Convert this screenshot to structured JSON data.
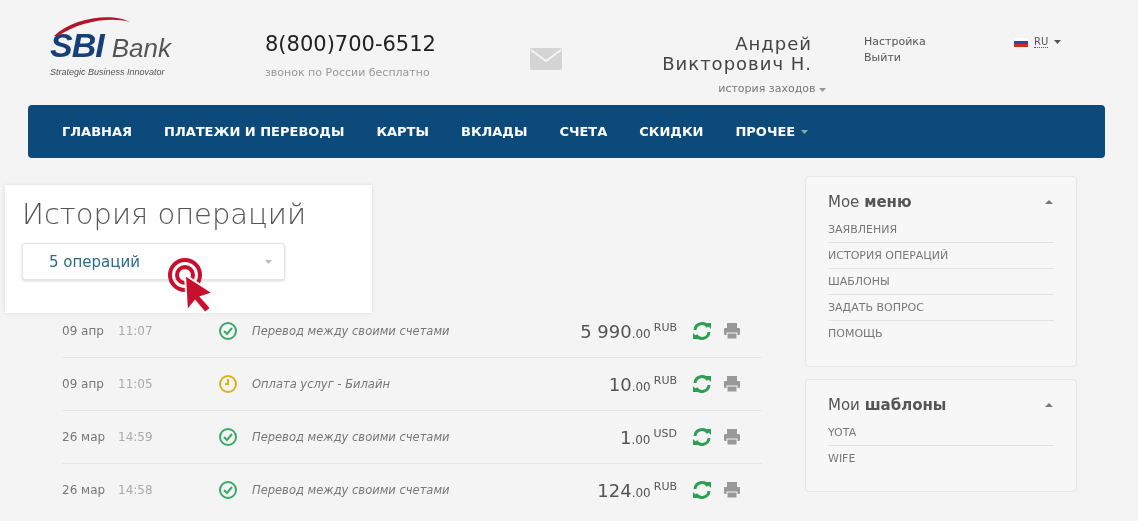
{
  "header": {
    "logo": {
      "name": "SBI",
      "suffix": "Bank",
      "tagline": "Strategic Business Innovator"
    },
    "phone": {
      "number": "8(800)700-6512",
      "note": "звонок по России бесплатно"
    },
    "user": {
      "name_line1": "Андрей",
      "name_line2": "Викторович Н.",
      "history_link": "история заходов"
    },
    "links": [
      "Настройка",
      "Выйти"
    ],
    "language": "RU"
  },
  "nav": [
    {
      "label": "ГЛАВНАЯ",
      "has_dropdown": false
    },
    {
      "label": "ПЛАТЕЖИ И ПЕРЕВОДЫ",
      "has_dropdown": false
    },
    {
      "label": "КАРТЫ",
      "has_dropdown": false
    },
    {
      "label": "ВКЛАДЫ",
      "has_dropdown": false
    },
    {
      "label": "СЧЕТА",
      "has_dropdown": false
    },
    {
      "label": "СКИДКИ",
      "has_dropdown": false
    },
    {
      "label": "ПРОЧЕЕ",
      "has_dropdown": true
    }
  ],
  "page": {
    "title": "История операций",
    "filter": {
      "value": "5 операций"
    }
  },
  "operations": [
    {
      "date": "09 апр",
      "time": "11:07",
      "kind": "done",
      "description": "Перевод между своими счетами",
      "amount": "5 990",
      "cents": ".00",
      "currency": "RUB"
    },
    {
      "date": "09 апр",
      "time": "11:05",
      "kind": "pending",
      "description": "Оплата услуг - Билайн",
      "amount": "10",
      "cents": ".00",
      "currency": "RUB"
    },
    {
      "date": "26 мар",
      "time": "14:59",
      "kind": "done",
      "description": "Перевод между своими счетами",
      "amount": "1",
      "cents": ".00",
      "currency": "USD"
    },
    {
      "date": "26 мар",
      "time": "14:58",
      "kind": "done",
      "description": "Перевод между своими счетами",
      "amount": "124",
      "cents": ".00",
      "currency": "RUB"
    }
  ],
  "sidebar": [
    {
      "title": "Мое **меню**",
      "expanded": true,
      "items": [
        "ЗАЯВЛЕНИЯ",
        "ИСТОРИЯ ОПЕРАЦИЙ",
        "ШАБЛОНЫ",
        "ЗАДАТЬ ВОПРОС",
        "ПОМОЩЬ"
      ]
    },
    {
      "title": "Мои **шаблоны**",
      "expanded": true,
      "items": [
        "YOTA",
        "WIFE"
      ]
    }
  ]
}
